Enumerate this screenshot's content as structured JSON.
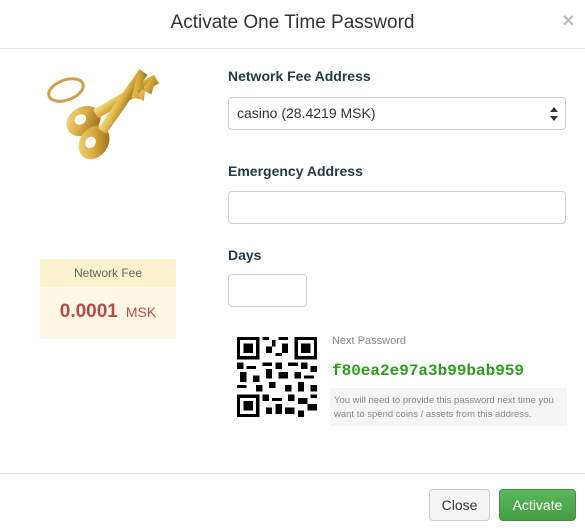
{
  "dialog": {
    "title": "Activate One Time Password"
  },
  "fee": {
    "header": "Network Fee",
    "amount": "0.0001",
    "unit": "MSK"
  },
  "form": {
    "network_fee_label": "Network Fee Address",
    "network_fee_value": "casino (28.4219 MSK)",
    "emergency_label": "Emergency Address",
    "emergency_value": "",
    "days_label": "Days",
    "days_value": ""
  },
  "next_password": {
    "label": "Next Password",
    "value": "f80ea2e97a3b99bab959",
    "note": "You will need to provide this password next time you want to spend coins / assets from this address."
  },
  "buttons": {
    "close": "Close",
    "activate": "Activate"
  },
  "colors": {
    "accent_green": "#5cb85c",
    "password_green": "#2e9b1c",
    "fee_red": "#b94a48",
    "fee_bg": "#fcf8e3"
  },
  "icons": {
    "close": "close-icon",
    "keys": "keys-icon",
    "qr": "qr-code-icon",
    "select_arrows": "select-arrows-icon"
  }
}
